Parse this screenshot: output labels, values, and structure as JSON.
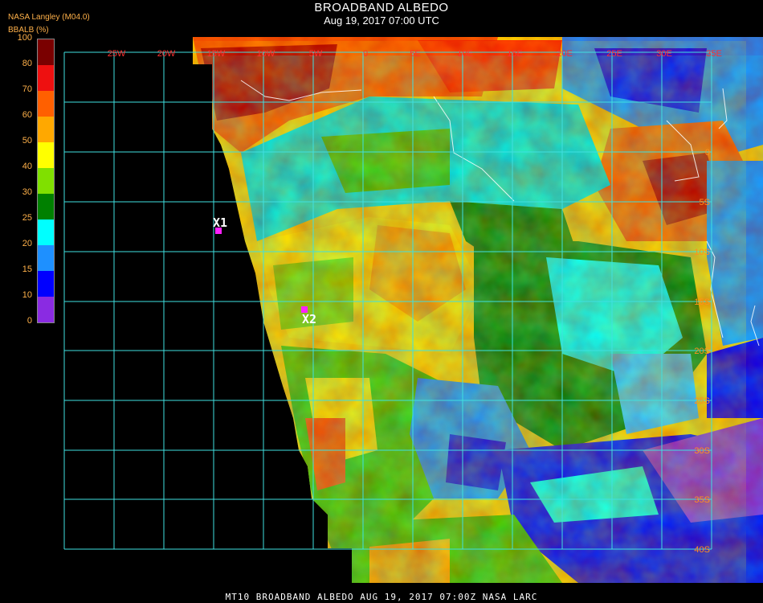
{
  "title": "BROADBAND ALBEDO",
  "subtitle": "Aug 19, 2017 07:00 UTC",
  "source": "NASA Langley (M04.0)",
  "unit": "BBALB (%)",
  "footer": "MT10  BROADBAND ALBEDO   AUG 19, 2017 07:00Z   NASA LARC",
  "legend": {
    "ticks": [
      "100",
      "80",
      "70",
      "60",
      "50",
      "40",
      "30",
      "25",
      "20",
      "15",
      "10",
      "0"
    ],
    "bins": [
      {
        "range": "80-100",
        "color": "#7a0000"
      },
      {
        "range": "70-80",
        "color": "#ee1010"
      },
      {
        "range": "60-70",
        "color": "#ff6000"
      },
      {
        "range": "50-60",
        "color": "#ffa800"
      },
      {
        "range": "40-50",
        "color": "#ffff00"
      },
      {
        "range": "30-40",
        "color": "#80e000"
      },
      {
        "range": "25-30",
        "color": "#008000"
      },
      {
        "range": "20-25",
        "color": "#00ffff"
      },
      {
        "range": "15-20",
        "color": "#1e90ff"
      },
      {
        "range": "10-15",
        "color": "#0000ff"
      },
      {
        "range": "0-10",
        "color": "#8a2be2"
      }
    ]
  },
  "grid_labels": {
    "top": [
      "25W",
      "20W",
      "15W",
      "10W",
      "5W",
      "0",
      "5E",
      "10E",
      "15E",
      "20E",
      "25E",
      "30E",
      "35E"
    ],
    "right": [
      "0",
      "5S",
      "10S",
      "15S",
      "20S",
      "25S",
      "30S",
      "35S",
      "40S"
    ]
  },
  "markers": [
    {
      "id": "X1"
    },
    {
      "id": "X2"
    }
  ]
}
